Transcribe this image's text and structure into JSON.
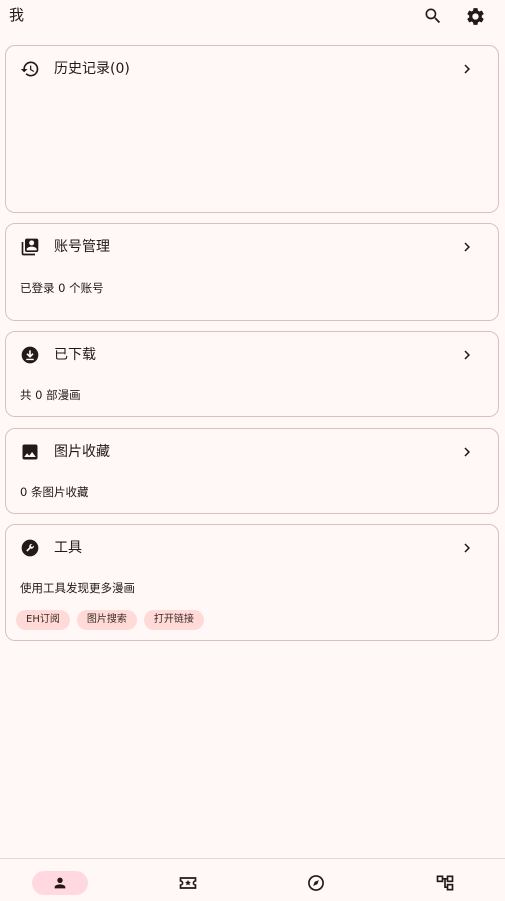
{
  "appbar": {
    "title": "我",
    "search_icon": "search-icon",
    "settings_icon": "gear-icon"
  },
  "cards": {
    "history": {
      "title": "历史记录(0)",
      "icon": "history-icon"
    },
    "accounts": {
      "title": "账号管理",
      "subtitle": "已登录 0 个账号",
      "icon": "account-box-icon"
    },
    "downloads": {
      "title": "已下载",
      "subtitle": "共 0 部漫画",
      "icon": "download-icon"
    },
    "images": {
      "title": "图片收藏",
      "subtitle": "0 条图片收藏",
      "icon": "image-icon"
    },
    "tools": {
      "title": "工具",
      "subtitle": "使用工具发现更多漫画",
      "icon": "wrench-icon",
      "chips": [
        "EH订阅",
        "图片搜索",
        "打开链接"
      ]
    }
  },
  "bottom_nav": {
    "items": [
      {
        "icon": "person-icon",
        "active": true
      },
      {
        "icon": "ticket-star-icon",
        "active": false
      },
      {
        "icon": "compass-icon",
        "active": false
      },
      {
        "icon": "hierarchy-icon",
        "active": false
      }
    ]
  },
  "colors": {
    "background": "#fff8f6",
    "card_border": "#d8c2bd",
    "chip_bg": "#ffdad6",
    "active_nav": "#ffd9df",
    "icon": "#231917"
  }
}
